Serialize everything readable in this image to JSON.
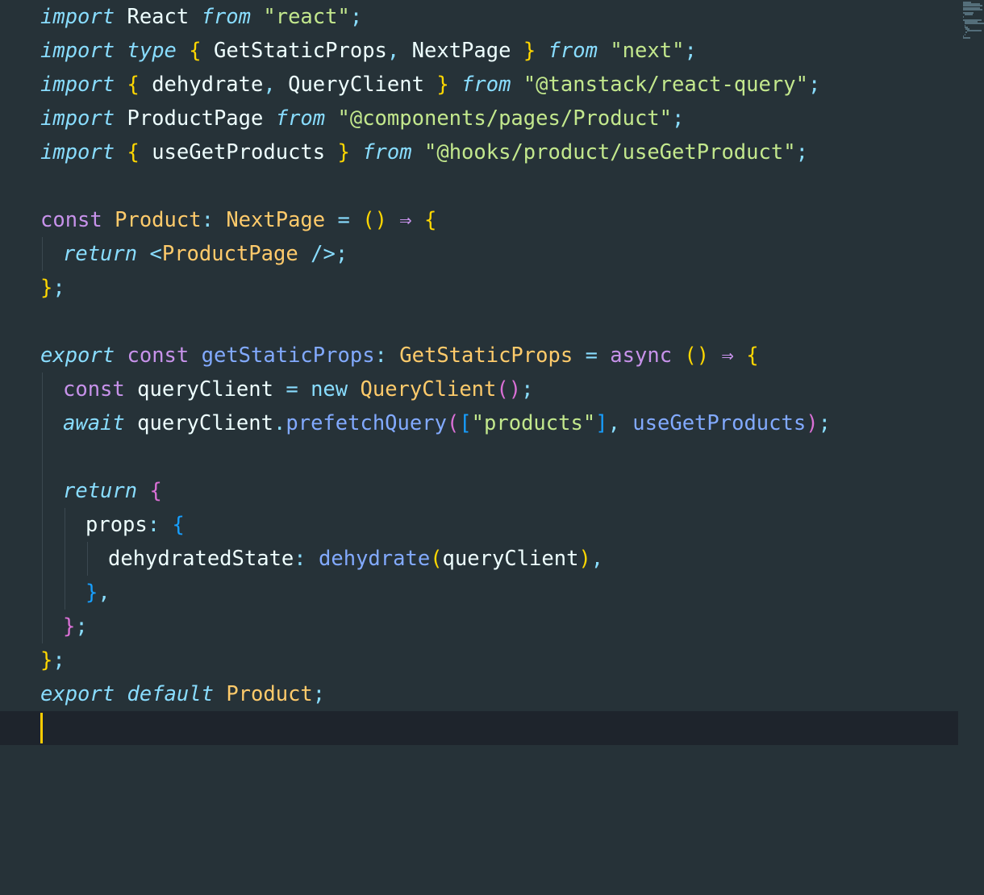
{
  "editor": {
    "theme_colors": {
      "background": "#263238",
      "current_line": "#1e242c",
      "cursor": "#ffcc00",
      "keyword_italic": "#89ddff",
      "keyword": "#c792ea",
      "string": "#c3e88d",
      "type": "#ffcb6b",
      "function": "#82aaff",
      "bracket_level1": "#ffd700",
      "bracket_level2": "#da70d6",
      "bracket_level3": "#179fff"
    },
    "lines": [
      {
        "indent": 0,
        "tokens": [
          {
            "t": "import",
            "c": "kw-i"
          },
          {
            "t": " React ",
            "c": "id"
          },
          {
            "t": "from",
            "c": "kw-i"
          },
          {
            "t": " ",
            "c": "id"
          },
          {
            "t": "\"react\"",
            "c": "str"
          },
          {
            "t": ";",
            "c": "punc"
          }
        ]
      },
      {
        "indent": 0,
        "tokens": [
          {
            "t": "import",
            "c": "kw-i"
          },
          {
            "t": " ",
            "c": "id"
          },
          {
            "t": "type",
            "c": "kw-i"
          },
          {
            "t": " ",
            "c": "id"
          },
          {
            "t": "{",
            "c": "b1"
          },
          {
            "t": " GetStaticProps",
            "c": "id"
          },
          {
            "t": ",",
            "c": "punc"
          },
          {
            "t": " NextPage ",
            "c": "id"
          },
          {
            "t": "}",
            "c": "b1"
          },
          {
            "t": " ",
            "c": "id"
          },
          {
            "t": "from",
            "c": "kw-i"
          },
          {
            "t": " ",
            "c": "id"
          },
          {
            "t": "\"next\"",
            "c": "str"
          },
          {
            "t": ";",
            "c": "punc"
          }
        ]
      },
      {
        "indent": 0,
        "tokens": [
          {
            "t": "import",
            "c": "kw-i"
          },
          {
            "t": " ",
            "c": "id"
          },
          {
            "t": "{",
            "c": "b1"
          },
          {
            "t": " dehydrate",
            "c": "id"
          },
          {
            "t": ",",
            "c": "punc"
          },
          {
            "t": " QueryClient ",
            "c": "id"
          },
          {
            "t": "}",
            "c": "b1"
          },
          {
            "t": " ",
            "c": "id"
          },
          {
            "t": "from",
            "c": "kw-i"
          },
          {
            "t": " ",
            "c": "id"
          },
          {
            "t": "\"@tanstack/react-query\"",
            "c": "str"
          },
          {
            "t": ";",
            "c": "punc"
          }
        ]
      },
      {
        "indent": 0,
        "tokens": [
          {
            "t": "import",
            "c": "kw-i"
          },
          {
            "t": " ProductPage ",
            "c": "id"
          },
          {
            "t": "from",
            "c": "kw-i"
          },
          {
            "t": " ",
            "c": "id"
          },
          {
            "t": "\"@components/pages/Product\"",
            "c": "str"
          },
          {
            "t": ";",
            "c": "punc"
          }
        ]
      },
      {
        "indent": 0,
        "tokens": [
          {
            "t": "import",
            "c": "kw-i"
          },
          {
            "t": " ",
            "c": "id"
          },
          {
            "t": "{",
            "c": "b1"
          },
          {
            "t": " useGetProducts ",
            "c": "id"
          },
          {
            "t": "}",
            "c": "b1"
          },
          {
            "t": " ",
            "c": "id"
          },
          {
            "t": "from",
            "c": "kw-i"
          },
          {
            "t": " ",
            "c": "id"
          },
          {
            "t": "\"@hooks/product/useGetProduct\"",
            "c": "str"
          },
          {
            "t": ";",
            "c": "punc"
          }
        ]
      },
      {
        "indent": 0,
        "tokens": []
      },
      {
        "indent": 0,
        "tokens": [
          {
            "t": "const",
            "c": "kw"
          },
          {
            "t": " ",
            "c": "id"
          },
          {
            "t": "Product",
            "c": "type"
          },
          {
            "t": ":",
            "c": "punc"
          },
          {
            "t": " ",
            "c": "id"
          },
          {
            "t": "NextPage",
            "c": "type"
          },
          {
            "t": " ",
            "c": "id"
          },
          {
            "t": "=",
            "c": "punc"
          },
          {
            "t": " ",
            "c": "id"
          },
          {
            "t": "()",
            "c": "b1"
          },
          {
            "t": " ",
            "c": "id"
          },
          {
            "t": "⇒",
            "c": "kw"
          },
          {
            "t": " ",
            "c": "id"
          },
          {
            "t": "{",
            "c": "b1"
          }
        ]
      },
      {
        "indent": 1,
        "tokens": [
          {
            "t": "return",
            "c": "kw-i"
          },
          {
            "t": " ",
            "c": "id"
          },
          {
            "t": "<",
            "c": "tag"
          },
          {
            "t": "ProductPage",
            "c": "type"
          },
          {
            "t": " ",
            "c": "id"
          },
          {
            "t": "/>",
            "c": "tag"
          },
          {
            "t": ";",
            "c": "punc"
          }
        ]
      },
      {
        "indent": 0,
        "tokens": [
          {
            "t": "}",
            "c": "b1"
          },
          {
            "t": ";",
            "c": "punc"
          }
        ]
      },
      {
        "indent": 0,
        "tokens": []
      },
      {
        "indent": 0,
        "tokens": [
          {
            "t": "export",
            "c": "kw-i"
          },
          {
            "t": " ",
            "c": "id"
          },
          {
            "t": "const",
            "c": "kw"
          },
          {
            "t": " ",
            "c": "id"
          },
          {
            "t": "getStaticProps",
            "c": "fn"
          },
          {
            "t": ":",
            "c": "punc"
          },
          {
            "t": " ",
            "c": "id"
          },
          {
            "t": "GetStaticProps",
            "c": "type"
          },
          {
            "t": " ",
            "c": "id"
          },
          {
            "t": "=",
            "c": "punc"
          },
          {
            "t": " ",
            "c": "id"
          },
          {
            "t": "async",
            "c": "kw"
          },
          {
            "t": " ",
            "c": "id"
          },
          {
            "t": "()",
            "c": "b1"
          },
          {
            "t": " ",
            "c": "id"
          },
          {
            "t": "⇒",
            "c": "kw"
          },
          {
            "t": " ",
            "c": "id"
          },
          {
            "t": "{",
            "c": "b1"
          }
        ]
      },
      {
        "indent": 1,
        "tokens": [
          {
            "t": "const",
            "c": "kw"
          },
          {
            "t": " queryClient ",
            "c": "id"
          },
          {
            "t": "=",
            "c": "punc"
          },
          {
            "t": " ",
            "c": "id"
          },
          {
            "t": "new",
            "c": "punc"
          },
          {
            "t": " ",
            "c": "id"
          },
          {
            "t": "QueryClient",
            "c": "type"
          },
          {
            "t": "()",
            "c": "b2"
          },
          {
            "t": ";",
            "c": "punc"
          }
        ]
      },
      {
        "indent": 1,
        "tokens": [
          {
            "t": "await",
            "c": "kw-i"
          },
          {
            "t": " queryClient",
            "c": "id"
          },
          {
            "t": ".",
            "c": "punc"
          },
          {
            "t": "prefetchQuery",
            "c": "fn"
          },
          {
            "t": "(",
            "c": "b2"
          },
          {
            "t": "[",
            "c": "b3"
          },
          {
            "t": "\"products\"",
            "c": "str"
          },
          {
            "t": "]",
            "c": "b3"
          },
          {
            "t": ",",
            "c": "punc"
          },
          {
            "t": " ",
            "c": "id"
          },
          {
            "t": "useGetProducts",
            "c": "fn"
          },
          {
            "t": ")",
            "c": "b2"
          },
          {
            "t": ";",
            "c": "punc"
          }
        ]
      },
      {
        "indent": 1,
        "tokens": []
      },
      {
        "indent": 1,
        "tokens": [
          {
            "t": "return",
            "c": "kw-i"
          },
          {
            "t": " ",
            "c": "id"
          },
          {
            "t": "{",
            "c": "b2"
          }
        ]
      },
      {
        "indent": 2,
        "tokens": [
          {
            "t": "props",
            "c": "id"
          },
          {
            "t": ":",
            "c": "punc"
          },
          {
            "t": " ",
            "c": "id"
          },
          {
            "t": "{",
            "c": "b3"
          }
        ]
      },
      {
        "indent": 3,
        "tokens": [
          {
            "t": "dehydratedState",
            "c": "id"
          },
          {
            "t": ":",
            "c": "punc"
          },
          {
            "t": " ",
            "c": "id"
          },
          {
            "t": "dehydrate",
            "c": "fn"
          },
          {
            "t": "(",
            "c": "b1"
          },
          {
            "t": "queryClient",
            "c": "id"
          },
          {
            "t": ")",
            "c": "b1"
          },
          {
            "t": ",",
            "c": "punc"
          }
        ]
      },
      {
        "indent": 2,
        "tokens": [
          {
            "t": "}",
            "c": "b3"
          },
          {
            "t": ",",
            "c": "punc"
          }
        ]
      },
      {
        "indent": 1,
        "tokens": [
          {
            "t": "}",
            "c": "b2"
          },
          {
            "t": ";",
            "c": "punc"
          }
        ]
      },
      {
        "indent": 0,
        "tokens": [
          {
            "t": "}",
            "c": "b1"
          },
          {
            "t": ";",
            "c": "punc"
          }
        ]
      },
      {
        "indent": 0,
        "tokens": [
          {
            "t": "export",
            "c": "kw-i"
          },
          {
            "t": " ",
            "c": "id"
          },
          {
            "t": "default",
            "c": "kw-i"
          },
          {
            "t": " ",
            "c": "id"
          },
          {
            "t": "Product",
            "c": "type"
          },
          {
            "t": ";",
            "c": "punc"
          }
        ]
      },
      {
        "indent": 0,
        "current": true,
        "tokens": []
      }
    ]
  }
}
